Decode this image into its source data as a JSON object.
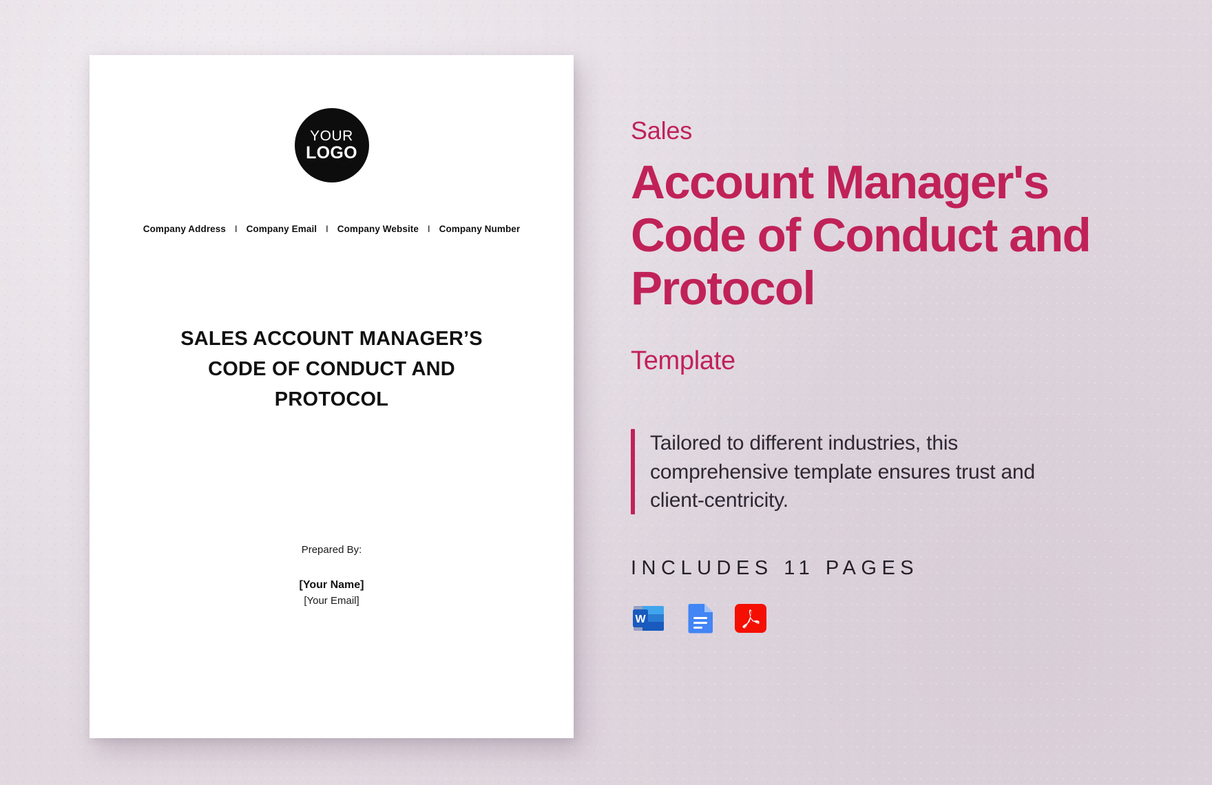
{
  "background": {
    "color": "#e1d8e0",
    "texture": "stucco-wall"
  },
  "brand": {
    "accent_color": "#c02258",
    "text_color": "#2e2833"
  },
  "document_preview": {
    "logo": {
      "line1": "YOUR",
      "line2": "LOGO",
      "shape": "circle",
      "background_color": "#0d0d0d"
    },
    "company_info": [
      "Company Address",
      "Company Email",
      "Company Website",
      "Company Number"
    ],
    "separator": "I",
    "title": "SALES ACCOUNT MANAGER’S CODE OF CONDUCT AND PROTOCOL",
    "prepared_by_label": "Prepared By:",
    "prepared_by_name": "[Your Name]",
    "prepared_by_email": "[Your Email]"
  },
  "info_panel": {
    "eyebrow": "Sales",
    "title": "Account Manager's Code of Conduct and Protocol",
    "subtitle": "Template",
    "description": "Tailored to different industries, this comprehensive template ensures trust and client-centricity.",
    "pages_label": "INCLUDES 11 PAGES",
    "page_count": 11,
    "formats": [
      {
        "name": "microsoft-word",
        "label": "W",
        "color": "#2b579a"
      },
      {
        "name": "google-docs",
        "label": "",
        "color": "#4285f4"
      },
      {
        "name": "adobe-pdf",
        "label": "A",
        "color": "#f40f02"
      }
    ]
  }
}
